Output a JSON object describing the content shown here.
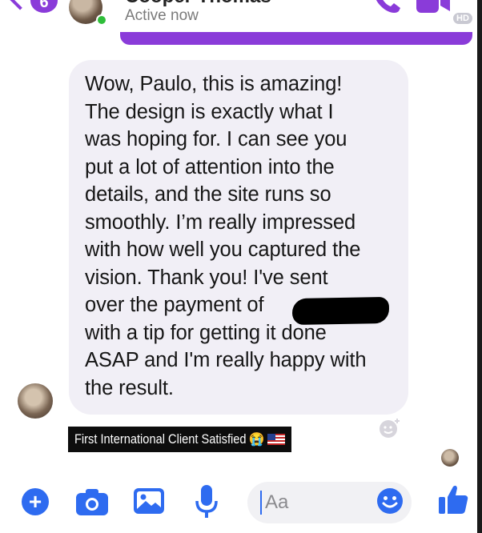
{
  "header": {
    "back_count": "6",
    "contact_name": "Cooper Thomas",
    "status": "Active now",
    "hd_label": "HD"
  },
  "message": {
    "text": "Wow, Paulo, this is amazing!\nThe design is exactly what I\nwas hoping for. I can see you\nput a lot of attention into the\ndetails, and the site runs so\nsmoothly. I’m really impressed\nwith how well you captured the\nvision. Thank you! I've sent\nover the payment of\nwith a tip for getting it done\nASAP and I'm really happy with\nthe result."
  },
  "caption": {
    "text": "First International Client Satisfied",
    "emoji_1": "😭",
    "emoji_2": "us-flag"
  },
  "composer": {
    "placeholder": "Aa"
  },
  "colors": {
    "accent": "#8a3bd9",
    "blue": "#2e6bf0",
    "bubble": "#f1eff6",
    "online": "#2fbe3a"
  },
  "icons": [
    "chevron-left-icon",
    "phone-icon",
    "video-camera-icon",
    "plus-icon",
    "camera-icon",
    "image-icon",
    "microphone-icon",
    "emoji-icon",
    "thumbs-up-icon",
    "add-reaction-icon"
  ]
}
